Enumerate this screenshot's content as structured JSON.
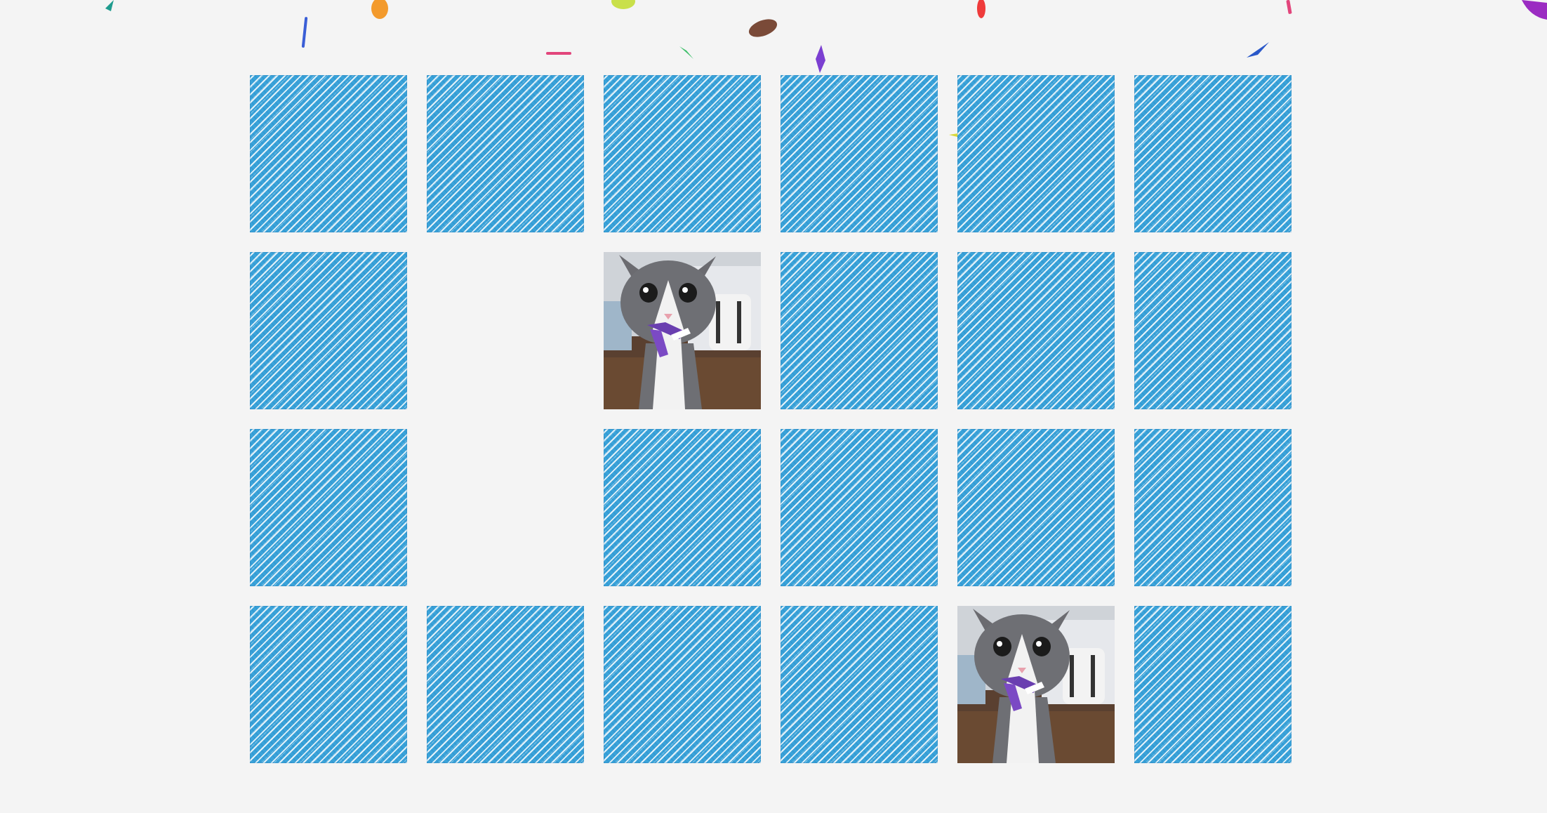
{
  "game": {
    "name": "memory-card-game",
    "columns": 6,
    "rows": 4,
    "board": [
      [
        "back",
        "back",
        "back",
        "back",
        "back",
        "back"
      ],
      [
        "back",
        "matched",
        "face-kitten",
        "back",
        "back",
        "back"
      ],
      [
        "back",
        "matched",
        "back",
        "back",
        "back",
        "back"
      ],
      [
        "back",
        "back",
        "back",
        "back",
        "face-kitten",
        "back"
      ]
    ],
    "card_back_pattern": "blue-denim-diagonal",
    "revealed_image": "grey-white-kitten-with-purple-harness"
  },
  "colors": {
    "background": "#f4f4f4",
    "card_back": "#3aa3d9",
    "confetti": [
      "#1f9b8e",
      "#3a5ed6",
      "#f39a2c",
      "#e2457b",
      "#c9e04a",
      "#3fbf6a",
      "#7a4a38",
      "#7b3fd1",
      "#ef3b3b",
      "#9b2cc2",
      "#d8d83a",
      "#2a58c9"
    ]
  },
  "effects": {
    "confetti": "celebration-confetti-falling"
  }
}
